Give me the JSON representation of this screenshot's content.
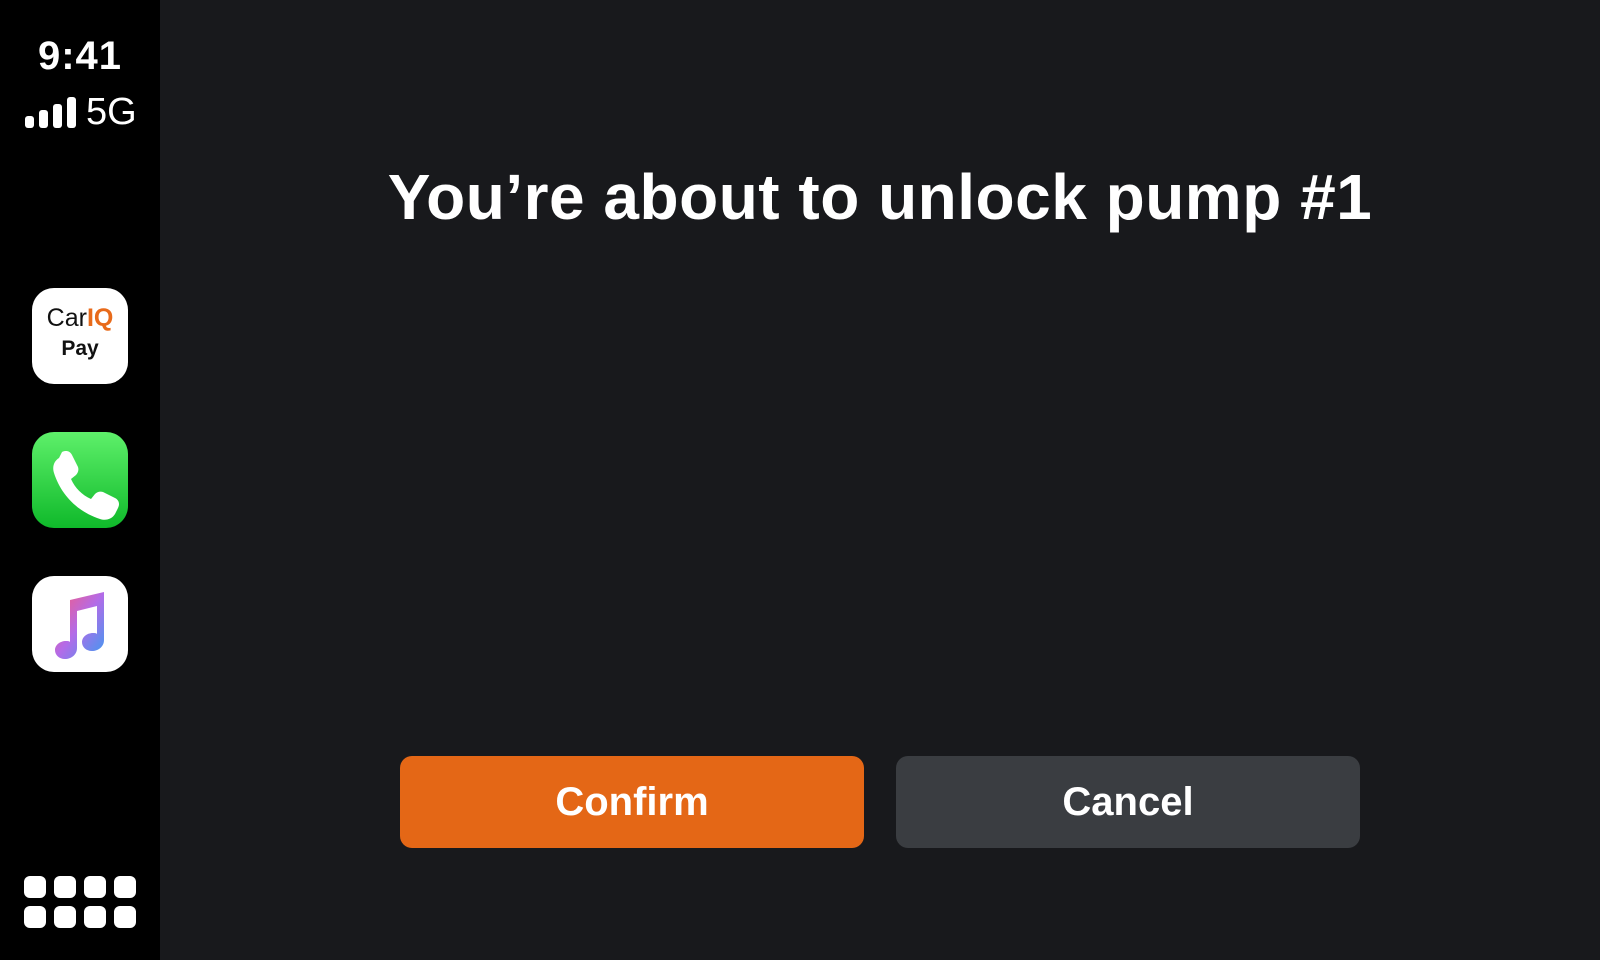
{
  "status_bar": {
    "time": "9:41",
    "network": "5G",
    "signal_bars": 4
  },
  "dock": {
    "apps": [
      {
        "name": "CarIQ Pay",
        "brand_line1_prefix": "Car",
        "brand_line1_accent": "IQ",
        "brand_line2": "Pay",
        "icon": "cariq-pay-icon"
      },
      {
        "name": "Phone",
        "icon": "phone-icon"
      },
      {
        "name": "Music",
        "icon": "music-icon"
      }
    ],
    "home_icon": "app-grid-icon"
  },
  "dialog": {
    "message": "You’re about to unlock pump #1",
    "confirm_label": "Confirm",
    "cancel_label": "Cancel"
  },
  "colors": {
    "accent_orange": "#e46716",
    "cancel_gray": "#3a3d41",
    "background": "#18191c",
    "sidebar": "#000000"
  }
}
